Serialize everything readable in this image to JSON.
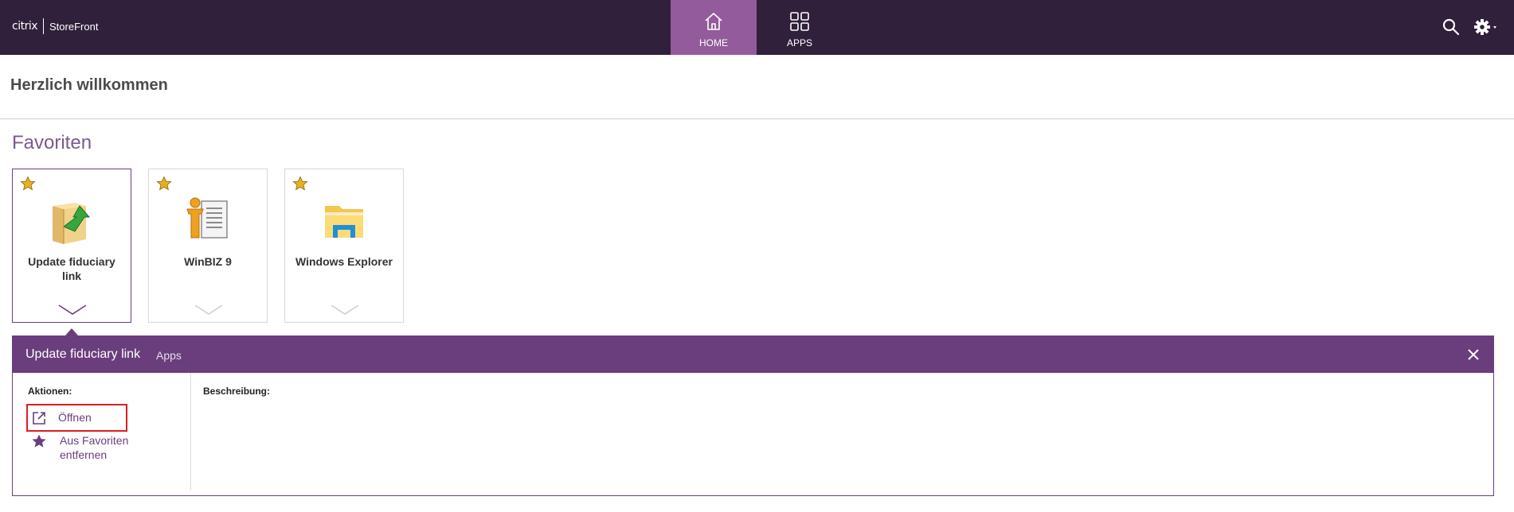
{
  "header": {
    "brand": "citrix",
    "product": "StoreFront",
    "tabs": [
      {
        "label": "HOME",
        "icon": "home-icon",
        "active": true
      },
      {
        "label": "APPS",
        "icon": "grid-icon",
        "active": false
      }
    ],
    "search_icon": "search-icon",
    "settings_icon": "gear-icon"
  },
  "welcome": "Herzlich willkommen",
  "favorites": {
    "title": "Favoriten",
    "apps": [
      {
        "name": "Update fiduciary link",
        "icon": "folder-update-icon",
        "favorite": true,
        "selected": true
      },
      {
        "name": "WinBIZ 9",
        "icon": "winbiz-icon",
        "favorite": true,
        "selected": false
      },
      {
        "name": "Windows Explorer",
        "icon": "file-explorer-icon",
        "favorite": true,
        "selected": false
      }
    ]
  },
  "details": {
    "title": "Update fiduciary link",
    "category": "Apps",
    "actions_label": "Aktionen:",
    "actions": [
      {
        "label": "Öffnen",
        "icon": "open-external-icon"
      },
      {
        "label": "Aus Favoriten entfernen",
        "icon": "star-icon"
      }
    ],
    "description_label": "Beschreibung:"
  },
  "colors": {
    "topbar": "#30203b",
    "active_tab": "#935b9b",
    "accent": "#6a3e7c",
    "highlight_border": "#e01b22",
    "star": "#e8b020"
  }
}
